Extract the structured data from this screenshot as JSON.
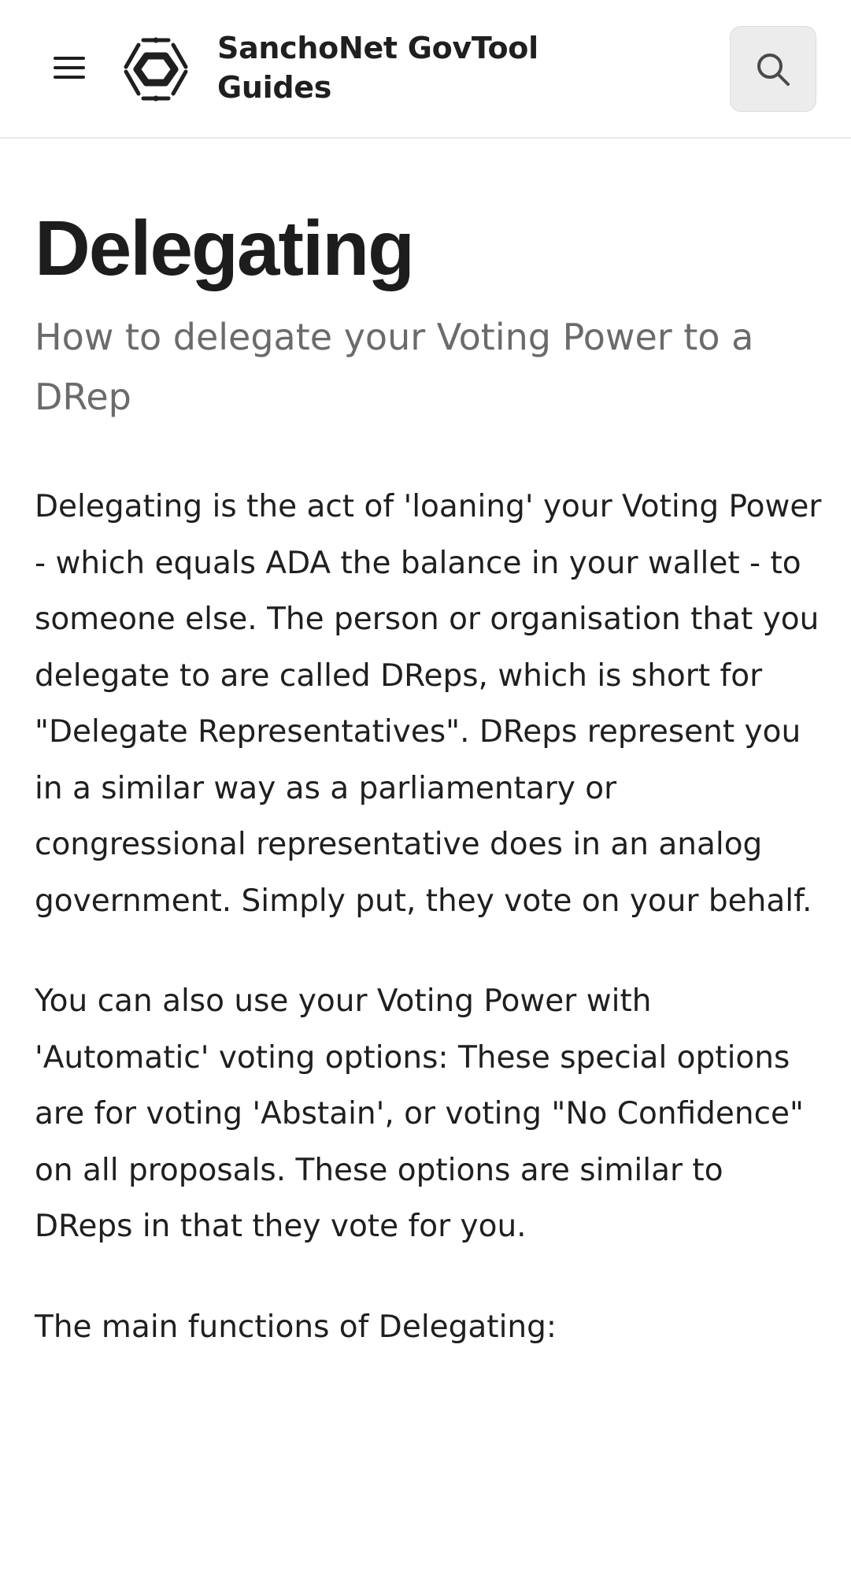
{
  "header": {
    "menu_icon": "hamburger-menu-icon",
    "logo_icon": "hexagon-logo-icon",
    "site_title_line1": "SanchoNet GovTool",
    "site_title_line2": "Guides",
    "search_icon": "search-icon"
  },
  "page": {
    "title": "Delegating",
    "subtitle": "How to delegate your Voting Power to a DRep",
    "paragraphs": [
      "Delegating is the act of 'loaning' your Voting Power - which equals ADA the balance in your wallet - to someone else. The person or organisation that you delegate to are called DReps, which is short for \"Delegate Representatives\". DReps represent you in a similar way as a parliamentary or congressional representative does in an analog government. Simply put, they vote on your behalf.",
      "You can also use your Voting Power with 'Automatic' voting options: These special options are for voting 'Abstain',  or voting \"No Confidence\" on all proposals. These options are similar to DReps in that they vote for you.",
      "The main functions of Delegating:"
    ]
  },
  "colors": {
    "text": "#1f1f1f",
    "subtitle": "#6b6b6b",
    "search_bg": "#ececec",
    "divider": "#ebebeb"
  }
}
